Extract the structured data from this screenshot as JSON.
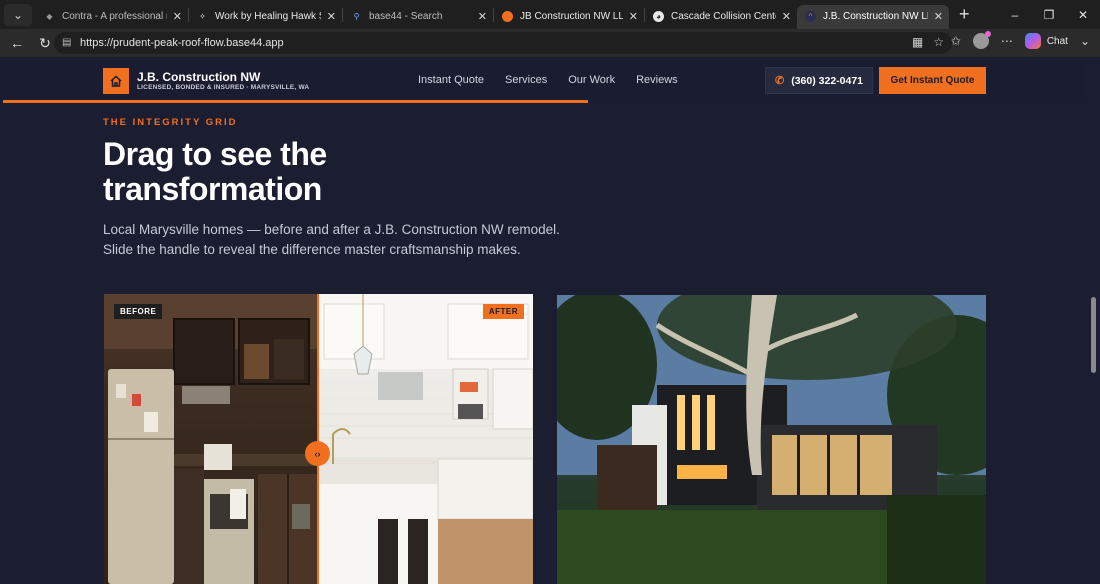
{
  "browser": {
    "tabs": [
      {
        "title": "Contra - A professional netw",
        "active": false
      },
      {
        "title": "Work by Healing Hawk Studio",
        "active": false
      },
      {
        "title": "base44 - Search",
        "active": false
      },
      {
        "title": "JB Construction NW LLC | Bas",
        "active": false
      },
      {
        "title": "Cascade Collision Center Inc.",
        "active": false
      },
      {
        "title": "J.B. Construction NW LLC — I",
        "active": true
      }
    ],
    "url": "https://prudent-peak-roof-flow.base44.app",
    "chat_label": "Chat"
  },
  "site": {
    "brand": "J.B. Construction NW",
    "tagline": "LICENSED, BONDED & INSURED · MARYSVILLE, WA",
    "nav": [
      "Instant Quote",
      "Services",
      "Our Work",
      "Reviews"
    ],
    "phone": "(360) 322-0471",
    "cta": "Get Instant Quote",
    "scroll_progress": 0.54
  },
  "hero": {
    "eyebrow": "THE INTEGRITY GRID",
    "headline": "Drag to see the transformation",
    "sub": "Local Marysville homes — before and after a J.B. Construction NW remodel. Slide the handle to reveal the difference master craftsmanship makes."
  },
  "compare": {
    "before_label": "BEFORE",
    "after_label": "AFTER",
    "slider_position": 0.5
  },
  "colors": {
    "accent": "#f1701f",
    "background": "#1b1d30"
  }
}
